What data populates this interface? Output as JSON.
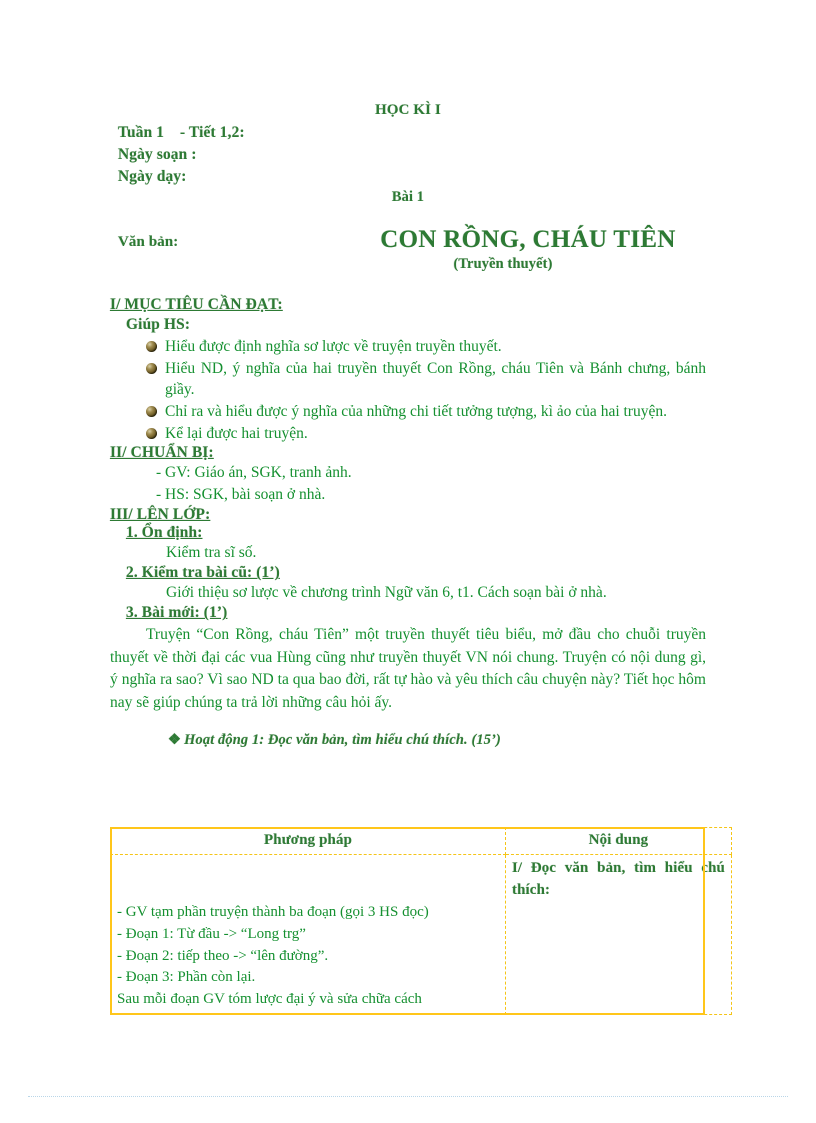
{
  "document": {
    "semester_heading": "HỌC KÌ I",
    "lesson_heading": "Bài 1",
    "meta": {
      "week_period": "Tuần 1    - Tiết 1,2:",
      "date_written": "Ngày soạn :",
      "date_taught": "Ngày dạy:"
    },
    "text_label": "Văn bản:",
    "title": "CON RỒNG, CHÁU TIÊN",
    "subtitle": "(Truyền thuyết)",
    "section_1": {
      "heading": "I/ MỤC TIÊU CẦN ĐẠT:",
      "lead": "Giúp HS:",
      "goals": [
        "Hiểu được định nghĩa sơ lược về truyện truyền thuyết.",
        "Hiểu ND, ý nghĩa của hai truyền thuyết Con Rồng, cháu Tiên và Bánh chưng, bánh giầy.",
        "Chỉ ra và hiểu được ý nghĩa của những chi tiết tưởng tượng, kì ảo của hai truyện.",
        "Kể lại được hai truyện."
      ]
    },
    "section_2": {
      "heading": "II/ CHUẨN BỊ:",
      "items": [
        "- GV: Giáo án, SGK, tranh ảnh.",
        "- HS: SGK, bài soạn ở nhà."
      ]
    },
    "section_3": {
      "heading": "III/ LÊN LỚP:",
      "sub_1": {
        "heading": "1. Ổn định:",
        "body": "Kiểm tra sĩ số."
      },
      "sub_2": {
        "heading": "2. Kiểm tra bài cũ: (1’)",
        "body": "Giới thiệu sơ lược về chương trình Ngữ văn 6, t1. Cách soạn bài ở nhà."
      },
      "sub_3": {
        "heading": "3. Bài mới: (1’)",
        "body": "Truyện “Con Rồng, cháu Tiên” một truyền thuyết tiêu biểu, mở đầu cho chuỗi truyền thuyết về thời đại các vua Hùng cũng như truyền thuyết VN nói chung. Truyện có nội dung gì, ý nghĩa ra sao? Vì sao ND ta qua bao đời, rất tự hào và yêu thích câu chuyện này? Tiết học hôm nay sẽ giúp chúng ta trả lời những câu hỏi ấy."
      }
    },
    "activity": {
      "bullet": "❖",
      "text": "Hoạt động 1: Đọc văn bản, tìm hiểu chú thích. (15’)"
    },
    "table": {
      "headers": [
        "Phương pháp",
        "Nội dung"
      ],
      "method_lines": [
        "- GV tạm phần truyện thành ba đoạn (gọi 3 HS đọc)",
        "- Đoạn 1: Từ đầu -> “Long trg”",
        "- Đoạn 2: tiếp theo -> “lên đường”.",
        "- Đoạn 3: Phần còn lại.",
        "Sau mỗi đoạn GV tóm lược đại ý và sửa chữa cách"
      ],
      "content_lines": [
        "I/ Đọc văn bản, tìm hiểu chú thích:"
      ]
    },
    "colors": {
      "text_green": "#159030",
      "heading_green": "#2d7a34",
      "table_border_gold": "#ffc61a",
      "table_inner_gold": "#f5c518",
      "bullet_ball": "#6e5c26",
      "footer_rule": "#b9d6e8"
    }
  }
}
